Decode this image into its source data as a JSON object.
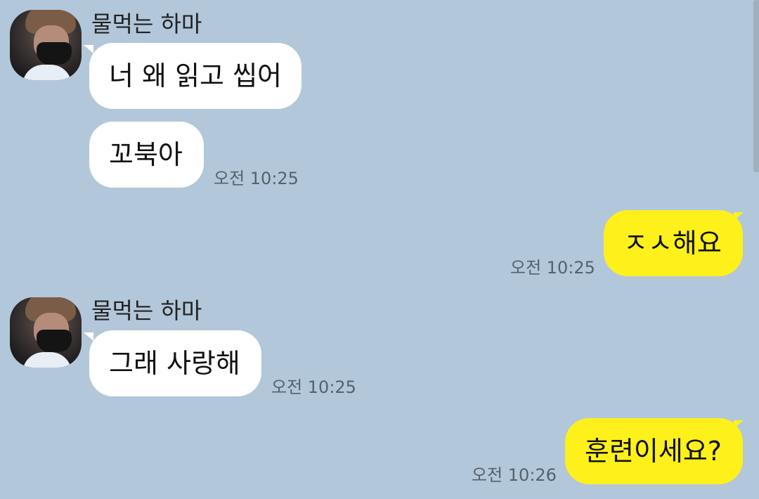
{
  "messages": [
    {
      "sender": "물먹는 하마",
      "text": "너 왜 읽고 씹어"
    },
    {
      "sender": "물먹는 하마",
      "text": "꼬북아",
      "time": "오전 10:25"
    },
    {
      "sender": "me",
      "text": "ㅈㅅ해요",
      "time": "오전 10:25"
    },
    {
      "sender": "물먹는 하마",
      "text": "그래 사랑해",
      "time": "오전 10:25"
    },
    {
      "sender": "me",
      "text": "훈련이세요?",
      "time": "오전 10:26"
    }
  ],
  "colors": {
    "background": "#b2c7da",
    "incoming_bubble": "#ffffff",
    "outgoing_bubble": "#fef01b",
    "timestamp": "#55616d"
  }
}
